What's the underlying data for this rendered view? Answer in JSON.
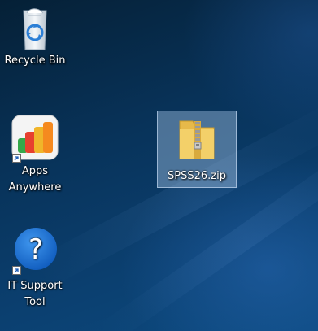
{
  "desktop": {
    "icons": [
      {
        "label": "Recycle Bin",
        "icon": "recycle-bin-icon"
      },
      {
        "label": "Apps\nAnywhere",
        "icon": "apps-anywhere-icon",
        "shortcut": true
      },
      {
        "label": "SPSS26.zip",
        "icon": "zip-folder-icon",
        "selected": true
      },
      {
        "label": "IT Support\nTool",
        "icon": "help-question-icon",
        "shortcut": true
      }
    ]
  },
  "colors": {
    "wallpaper": "#0b3f6f",
    "selection": "#a0bee1",
    "folder": "#f2cf63",
    "help_blue": "#1a6fd1"
  }
}
